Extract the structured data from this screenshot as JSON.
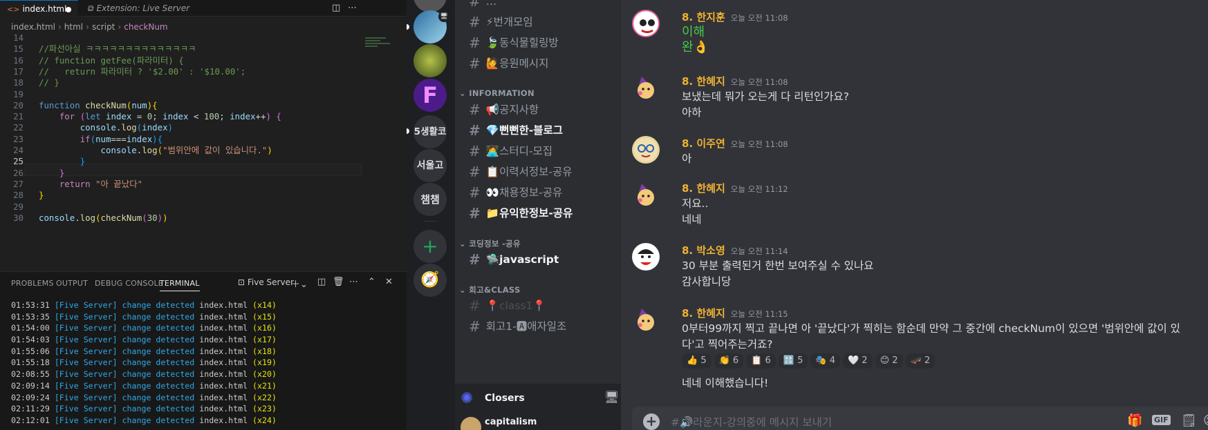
{
  "editor": {
    "tabs": [
      {
        "label": "index.html",
        "modified": true
      },
      {
        "label": "Extension: Live Server"
      }
    ],
    "breadcrumb": [
      "index.html",
      "html",
      "script",
      "checkNum"
    ],
    "lines": [
      {
        "n": "14",
        "html": ""
      },
      {
        "n": "15",
        "html": "<span class='cm'>//파선아실 ㅋㅋㅋㅋㅋㅋㅋㅋㅋㅋㅋㅋㅋㅋ</span>"
      },
      {
        "n": "16",
        "html": "<span class='cm'>// function getFee(파라미터) {</span>"
      },
      {
        "n": "17",
        "html": "<span class='cm'>//   return 파라미터 ? '$2.00' : '$10.00';</span>"
      },
      {
        "n": "18",
        "html": "<span class='cm'>// }</span>"
      },
      {
        "n": "19",
        "html": ""
      },
      {
        "n": "20",
        "html": "<span class='kw'>function</span> <span class='fn'>checkNum</span><span class='br'>(</span><span class='vr'>num</span><span class='br'>)</span><span class='br'>{</span>"
      },
      {
        "n": "21",
        "html": "    <span class='kc'>for</span> <span class='br2'>(</span><span class='kw'>let</span> <span class='vr'>index</span> <span class='pl'>=</span> <span class='nm'>0</span><span class='pl'>;</span> <span class='vr'>index</span> <span class='pl'>&lt;</span> <span class='nm'>100</span><span class='pl'>;</span> <span class='vr'>index</span><span class='pl'>++</span><span class='br2'>)</span> <span class='br2'>{</span>"
      },
      {
        "n": "22",
        "html": "        <span class='vr'>console</span><span class='pl'>.</span><span class='fn'>log</span><span class='br3'>(</span><span class='vr'>index</span><span class='br3'>)</span>"
      },
      {
        "n": "23",
        "html": "        <span class='kc'>if</span><span class='br3'>(</span><span class='vr'>num</span><span class='pl'>===</span><span class='vr'>index</span><span class='br3'>){</span>"
      },
      {
        "n": "24",
        "html": "            <span class='vr'>console</span><span class='pl'>.</span><span class='fn'>log</span><span class='br'>(</span><span class='st'>\"범위안에 값이 있습니다.\"</span><span class='br'>)</span>"
      },
      {
        "n": "25",
        "html": "        <span class='br3'>}</span>"
      },
      {
        "n": "26",
        "html": "    <span class='br2'>}</span>"
      },
      {
        "n": "27",
        "html": "    <span class='kc'>return</span> <span class='st'>\"아 끝났다\"</span>"
      },
      {
        "n": "28",
        "html": "<span class='br'>}</span>"
      },
      {
        "n": "29",
        "html": ""
      },
      {
        "n": "30",
        "html": "<span class='vr'>console</span><span class='pl'>.</span><span class='fn'>log</span><span class='br'>(</span><span class='fn'>checkNum</span><span class='br2'>(</span><span class='nm'>30</span><span class='br2'>)</span><span class='br'>)</span>"
      }
    ],
    "current_line": "25"
  },
  "panel": {
    "tabs": [
      "PROBLEMS",
      "OUTPUT",
      "DEBUG CONSOLE",
      "TERMINAL"
    ],
    "active_tab": "TERMINAL",
    "terminal_name": "Five Server",
    "lines": [
      {
        "time": "01:53:31",
        "tag": "[Five Server]",
        "msg": "change detected",
        "file": "index.html",
        "count": "(x14)"
      },
      {
        "time": "01:53:35",
        "tag": "[Five Server]",
        "msg": "change detected",
        "file": "index.html",
        "count": "(x15)"
      },
      {
        "time": "01:54:00",
        "tag": "[Five Server]",
        "msg": "change detected",
        "file": "index.html",
        "count": "(x16)"
      },
      {
        "time": "01:54:03",
        "tag": "[Five Server]",
        "msg": "change detected",
        "file": "index.html",
        "count": "(x17)"
      },
      {
        "time": "01:55:06",
        "tag": "[Five Server]",
        "msg": "change detected",
        "file": "index.html",
        "count": "(x18)"
      },
      {
        "time": "01:55:18",
        "tag": "[Five Server]",
        "msg": "change detected",
        "file": "index.html",
        "count": "(x19)"
      },
      {
        "time": "02:08:55",
        "tag": "[Five Server]",
        "msg": "change detected",
        "file": "index.html",
        "count": "(x20)"
      },
      {
        "time": "02:09:14",
        "tag": "[Five Server]",
        "msg": "change detected",
        "file": "index.html",
        "count": "(x21)"
      },
      {
        "time": "02:09:24",
        "tag": "[Five Server]",
        "msg": "change detected",
        "file": "index.html",
        "count": "(x22)"
      },
      {
        "time": "02:11:29",
        "tag": "[Five Server]",
        "msg": "change detected",
        "file": "index.html",
        "count": "(x23)"
      },
      {
        "time": "02:12:01",
        "tag": "[Five Server]",
        "msg": "change detected",
        "file": "index.html",
        "count": "(x24)"
      }
    ]
  },
  "servers": [
    {
      "label": "",
      "color": "#4d7ea8"
    },
    {
      "label": "",
      "color": "#7a9b3a"
    },
    {
      "label": "F",
      "color": "#6a1fb5"
    },
    {
      "label": "5생활코",
      "color": "#313338"
    },
    {
      "label": "서울고",
      "color": "#313338"
    },
    {
      "label": "챔챔",
      "color": "#313338"
    }
  ],
  "channels": {
    "top": [
      {
        "name": "⚡번개모임",
        "unread": false
      },
      {
        "name": "🍃동식물힐링방",
        "unread": false
      },
      {
        "name": "🙋응원메시지",
        "unread": false
      }
    ],
    "cat_info": "INFORMATION",
    "info": [
      {
        "name": "📢공지사항",
        "unread": false
      },
      {
        "name": "💎뻔뻔한-블로그",
        "unread": true
      },
      {
        "name": "👩‍💻스터디-모집",
        "unread": false
      },
      {
        "name": "📋이력서정보-공유",
        "unread": false
      },
      {
        "name": "👀채용정보-공유",
        "unread": false
      },
      {
        "name": "📁유익한정보-공유",
        "unread": true
      }
    ],
    "cat_code": "코딩정보 -공유",
    "code": [
      {
        "name": "🛸javascript",
        "unread": true
      }
    ],
    "cat_class": "회고&CLASS",
    "cls": [
      {
        "name": "📍class1📍",
        "unread": false,
        "muted": true
      },
      {
        "name": "회고1-🅰애자일조",
        "unread": false
      }
    ],
    "voice": "Closers",
    "user": "capitalism"
  },
  "chat": {
    "messages": [
      {
        "user": "8. 한지훈",
        "time": "오늘 오전 11:08",
        "lines": [
          "이해",
          "완👌"
        ],
        "handwritten": true
      },
      {
        "user": "8. 한혜지",
        "time": "오늘 오전 11:08",
        "lines": [
          "보냈는데 뭐가 오는게 다 리턴인가요?",
          "아하"
        ]
      },
      {
        "user": "8. 이주연",
        "time": "오늘 오전 11:08",
        "lines": [
          "아"
        ]
      },
      {
        "user": "8. 한혜지",
        "time": "오늘 오전 11:12",
        "lines": [
          "저요..",
          "네네"
        ]
      },
      {
        "user": "8. 박소영",
        "time": "오늘 오전 11:14",
        "lines": [
          "30 부분 출력된거 한번 보여주실 수 있나요",
          "감사합니당"
        ]
      },
      {
        "user": "8. 한혜지",
        "time": "오늘 오전 11:15",
        "lines": [
          "0부터99까지 찍고 끝나면 아 '끝났다'가 찍히는 함순데 만약 그 중간에 checkNum이 있으면 '범위안에 값이 있",
          "다'고 찍어주는거죠?"
        ],
        "reactions": [
          {
            "e": "👍",
            "n": "5"
          },
          {
            "e": "👏",
            "n": "6"
          },
          {
            "e": "📋",
            "n": "6"
          },
          {
            "e": "🔠",
            "n": "5"
          },
          {
            "e": "🎭",
            "n": "4"
          },
          {
            "e": "🤍",
            "n": "2"
          },
          {
            "e": "😊",
            "n": "2"
          },
          {
            "e": "🛹",
            "n": "2"
          }
        ],
        "after": "네네 이해했습니다!"
      }
    ],
    "input_placeholder": "#🔊라운지-강의중에 메시지 보내기"
  }
}
